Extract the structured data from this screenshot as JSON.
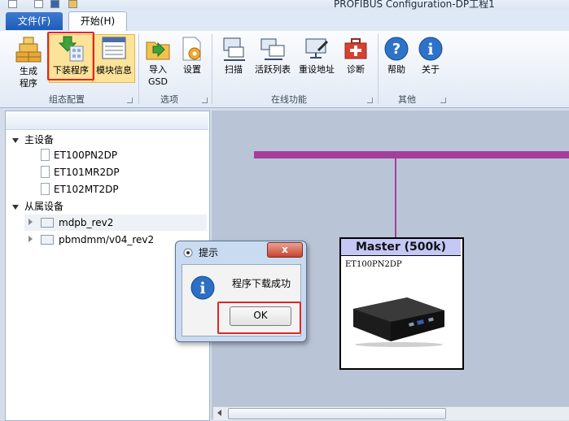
{
  "app": {
    "title": "PROFIBUS Configuration-DP工程1"
  },
  "tabs": {
    "file": "文件(F)",
    "home": "开始(H)"
  },
  "ribbon": {
    "generate": {
      "line1": "生成",
      "line2": "程序"
    },
    "download": "下装程序",
    "module_info": "模块信息",
    "import": {
      "line1": "导入",
      "line2": "GSD"
    },
    "settings": "设置",
    "scan": "扫描",
    "active_list": "活跃列表",
    "reset_address": "重设地址",
    "diagnose": "诊断",
    "help": "帮助",
    "about": "关于",
    "groups": {
      "config": "组态配置",
      "options": "选项",
      "online": "在线功能",
      "other": "其他"
    }
  },
  "tree": {
    "master_label": "主设备",
    "masters": [
      "ET100PN2DP",
      "ET101MR2DP",
      "ET102MT2DP"
    ],
    "slave_label": "从属设备",
    "slaves": [
      "mdpb_rev2",
      "pbmdmm/v04_rev2"
    ]
  },
  "canvas": {
    "master_title": "Master (500k)",
    "master_device": "ET100PN2DP"
  },
  "dialog": {
    "title": "提示",
    "close": "x",
    "message": "程序下载成功",
    "ok": "OK"
  },
  "colors": {
    "bus": "#a43e9d",
    "highlight": "#e0262a",
    "master_header": "#c5c8f5"
  }
}
